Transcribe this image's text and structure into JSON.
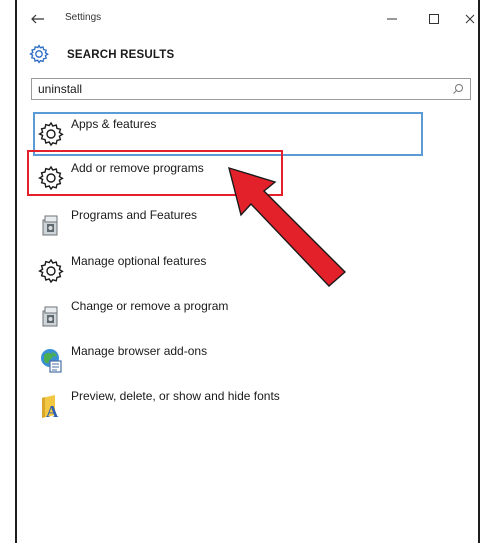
{
  "window": {
    "title": "Settings",
    "controls": {
      "minimize": "minimize",
      "maximize": "maximize",
      "close": "close"
    }
  },
  "header": {
    "title": "SEARCH RESULTS"
  },
  "search": {
    "value": "uninstall",
    "placeholder": ""
  },
  "results": [
    {
      "label": "Apps & features",
      "icon": "gear-icon"
    },
    {
      "label": "Add or remove programs",
      "icon": "gear-icon"
    },
    {
      "label": "Programs and Features",
      "icon": "control-panel-programs-icon"
    },
    {
      "label": "Manage optional features",
      "icon": "gear-icon"
    },
    {
      "label": "Change or remove a program",
      "icon": "control-panel-programs-icon"
    },
    {
      "label": "Manage browser add-ons",
      "icon": "internet-options-icon"
    },
    {
      "label": "Preview, delete, or show and hide fonts",
      "icon": "fonts-folder-icon"
    }
  ],
  "annotations": {
    "highlight_color": "#e3212b",
    "focus_color": "#5b9bd5",
    "highlighted_item": "Add or remove programs"
  }
}
